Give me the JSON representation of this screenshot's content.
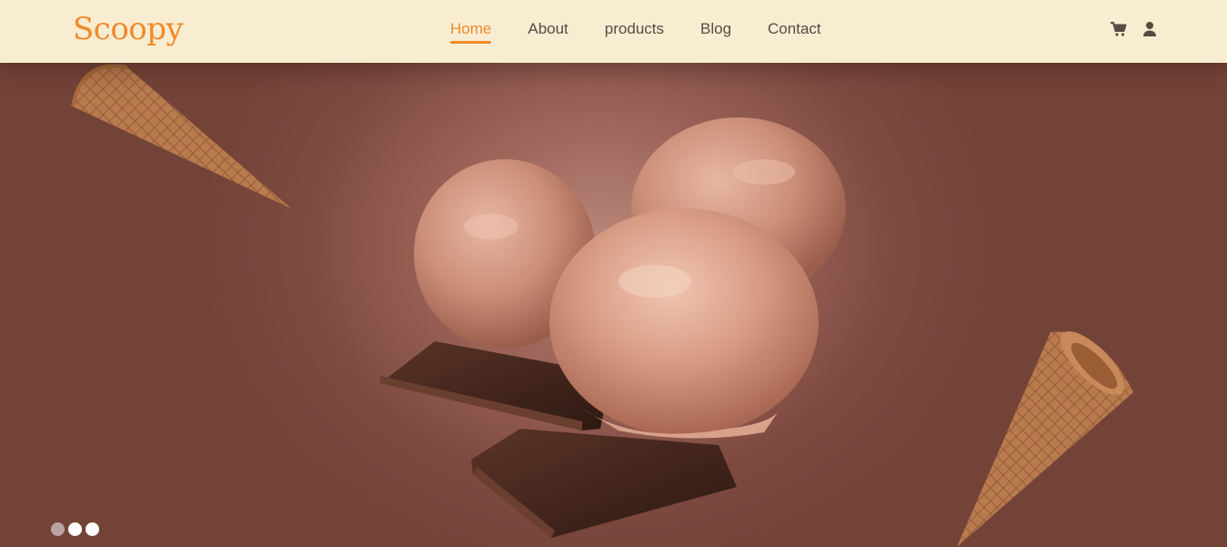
{
  "brand": {
    "logo_text": "Scoopy",
    "accent": "#f08a2a"
  },
  "nav": {
    "items": [
      {
        "label": "Home",
        "active": true
      },
      {
        "label": "About",
        "active": false
      },
      {
        "label": "products",
        "active": false
      },
      {
        "label": "Blog",
        "active": false
      },
      {
        "label": "Contact",
        "active": false
      }
    ]
  },
  "header_icons": [
    "cart-icon",
    "user-icon"
  ],
  "hero": {
    "image": "chocolate-ice-cream-scoops-with-chocolate-bars-and-waffle-cones",
    "slider": {
      "slides": 3,
      "active_index": 1
    }
  }
}
